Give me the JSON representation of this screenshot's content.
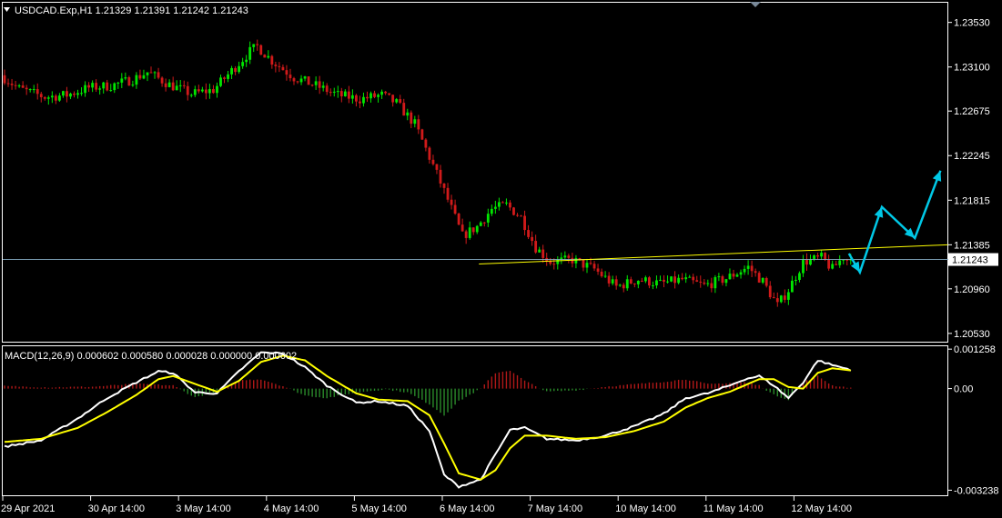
{
  "header": {
    "symbol_line": "USDCAD.Exp,H1  1.21329 1.21391 1.21242 1.21243",
    "macd_line": "MACD(12,26,9) 0.000602 0.000580 0.000028 0.000000 0.000602"
  },
  "colors": {
    "background": "#000000",
    "frame": "#ffffff",
    "bull_candle": "#00e600",
    "bear_candle": "#d01a1a",
    "trendline": "#ffff00",
    "price_line": "#8ab0c8",
    "projection_arrow": "#00c8e6",
    "macd_main": "#ffffff",
    "macd_signal": "#ffff00",
    "hist_up": "#b01818",
    "hist_down": "#2a8a2a"
  },
  "chart_data": [
    {
      "type": "candlestick",
      "series_name": "USDCAD.Exp,H1",
      "current_price": 1.21243,
      "current_price_label": "1.21243",
      "ylim": [
        1.2045,
        1.2372
      ],
      "y_ticks": [
        "1.23530",
        "1.23100",
        "1.22675",
        "1.22245",
        "1.21815",
        "1.21385",
        "1.20960",
        "1.20530"
      ],
      "y_tick_values": [
        1.2353,
        1.231,
        1.22675,
        1.22245,
        1.21815,
        1.21385,
        1.2096,
        1.2053
      ],
      "x_ticks": [
        "29 Apr 2021",
        "30 Apr 14:00",
        "3 May 14:00",
        "4 May 14:00",
        "5 May 14:00",
        "6 May 14:00",
        "7 May 14:00",
        "10 May 14:00",
        "11 May 14:00",
        "12 May 14:00"
      ],
      "x_tick_bars": [
        0,
        24,
        48,
        72,
        96,
        120,
        144,
        168,
        192,
        216
      ],
      "total_bars": 232,
      "close_path": [
        [
          0,
          1.2302
        ],
        [
          5,
          1.2289
        ],
        [
          12,
          1.2281
        ],
        [
          18,
          1.2283
        ],
        [
          24,
          1.229
        ],
        [
          30,
          1.2292
        ],
        [
          36,
          1.2298
        ],
        [
          40,
          1.2305
        ],
        [
          46,
          1.2293
        ],
        [
          52,
          1.2284
        ],
        [
          58,
          1.2288
        ],
        [
          64,
          1.231
        ],
        [
          68,
          1.2325
        ],
        [
          70,
          1.233
        ],
        [
          74,
          1.2316
        ],
        [
          80,
          1.23
        ],
        [
          86,
          1.2292
        ],
        [
          92,
          1.2283
        ],
        [
          98,
          1.2279
        ],
        [
          104,
          1.2283
        ],
        [
          108,
          1.2275
        ],
        [
          113,
          1.2255
        ],
        [
          118,
          1.2215
        ],
        [
          122,
          1.2182
        ],
        [
          126,
          1.2147
        ],
        [
          130,
          1.2156
        ],
        [
          134,
          1.2173
        ],
        [
          138,
          1.2177
        ],
        [
          142,
          1.2165
        ],
        [
          146,
          1.2136
        ],
        [
          150,
          1.2122
        ],
        [
          156,
          1.2124
        ],
        [
          162,
          1.2115
        ],
        [
          168,
          1.2098
        ],
        [
          174,
          1.2105
        ],
        [
          180,
          1.2101
        ],
        [
          186,
          1.2105
        ],
        [
          192,
          1.2099
        ],
        [
          198,
          1.2106
        ],
        [
          204,
          1.2117
        ],
        [
          208,
          1.2103
        ],
        [
          212,
          1.208
        ],
        [
          215,
          1.2095
        ],
        [
          219,
          1.2122
        ],
        [
          224,
          1.2126
        ],
        [
          227,
          1.2115
        ],
        [
          230,
          1.2127
        ],
        [
          231,
          1.21243
        ]
      ],
      "trendline": {
        "from": [
          130,
          1.212
        ],
        "to": [
          258,
          1.21385
        ]
      },
      "projection": [
        [
          231,
          1.213
        ],
        [
          234,
          1.2112
        ],
        [
          240,
          1.2175
        ],
        [
          249,
          1.2145
        ],
        [
          256,
          1.221
        ]
      ]
    },
    {
      "type": "line+histogram",
      "series_name": "MACD(12,26,9)",
      "ylim": [
        -0.0034,
        0.00135
      ],
      "y_ticks": [
        "0.001258",
        "0.00",
        "-0.003238"
      ],
      "y_tick_values": [
        0.001258,
        0.0,
        -0.003238
      ],
      "main_path": [
        [
          0,
          -0.00185
        ],
        [
          10,
          -0.00165
        ],
        [
          20,
          -0.00095
        ],
        [
          28,
          -0.0003
        ],
        [
          36,
          0.0002
        ],
        [
          42,
          0.00055
        ],
        [
          46,
          0.0005
        ],
        [
          52,
          -0.00012
        ],
        [
          58,
          -0.00015
        ],
        [
          64,
          0.00055
        ],
        [
          70,
          0.00115
        ],
        [
          76,
          0.00112
        ],
        [
          82,
          0.00068
        ],
        [
          88,
          0.0001
        ],
        [
          96,
          -0.00045
        ],
        [
          102,
          -0.0004
        ],
        [
          110,
          -0.00055
        ],
        [
          116,
          -0.00135
        ],
        [
          120,
          -0.00275
        ],
        [
          124,
          -0.00312
        ],
        [
          130,
          -0.0029
        ],
        [
          134,
          -0.0021
        ],
        [
          138,
          -0.00132
        ],
        [
          142,
          -0.00125
        ],
        [
          148,
          -0.0016
        ],
        [
          156,
          -0.00165
        ],
        [
          164,
          -0.0015
        ],
        [
          172,
          -0.0012
        ],
        [
          180,
          -0.0008
        ],
        [
          186,
          -0.0003
        ],
        [
          192,
          -0.00015
        ],
        [
          198,
          0.0001
        ],
        [
          202,
          0.0003
        ],
        [
          206,
          0.0004
        ],
        [
          210,
          0.0001
        ],
        [
          214,
          -0.0003
        ],
        [
          218,
          0.0002
        ],
        [
          222,
          0.0009
        ],
        [
          226,
          0.00075
        ],
        [
          231,
          0.000602
        ]
      ],
      "signal_path": [
        [
          0,
          -0.0017
        ],
        [
          10,
          -0.0016
        ],
        [
          20,
          -0.00125
        ],
        [
          28,
          -0.00075
        ],
        [
          36,
          -0.0002
        ],
        [
          42,
          0.0003
        ],
        [
          46,
          0.0004
        ],
        [
          52,
          0.00015
        ],
        [
          58,
          -0.0001
        ],
        [
          64,
          0.00025
        ],
        [
          70,
          0.00085
        ],
        [
          76,
          0.00105
        ],
        [
          82,
          0.0009
        ],
        [
          88,
          0.0004
        ],
        [
          96,
          -0.00015
        ],
        [
          102,
          -0.00035
        ],
        [
          110,
          -0.0004
        ],
        [
          116,
          -0.00085
        ],
        [
          120,
          -0.00175
        ],
        [
          124,
          -0.0027
        ],
        [
          130,
          -0.0029
        ],
        [
          134,
          -0.0026
        ],
        [
          138,
          -0.0019
        ],
        [
          142,
          -0.0015
        ],
        [
          148,
          -0.0015
        ],
        [
          156,
          -0.0016
        ],
        [
          164,
          -0.00155
        ],
        [
          172,
          -0.00135
        ],
        [
          180,
          -0.00105
        ],
        [
          186,
          -0.0006
        ],
        [
          192,
          -0.0003
        ],
        [
          198,
          -0.0001
        ],
        [
          202,
          0.0001
        ],
        [
          206,
          0.0003
        ],
        [
          210,
          0.0003
        ],
        [
          214,
          5e-05
        ],
        [
          218,
          0.0
        ],
        [
          222,
          0.0005
        ],
        [
          226,
          0.00065
        ],
        [
          231,
          0.00058
        ]
      ],
      "histogram_path": [
        [
          0,
          8e-05
        ],
        [
          12,
          4e-05
        ],
        [
          24,
          6e-05
        ],
        [
          36,
          0.00015
        ],
        [
          46,
          0.0001
        ],
        [
          52,
          -0.00028
        ],
        [
          58,
          -8e-05
        ],
        [
          64,
          0.00026
        ],
        [
          70,
          0.0003
        ],
        [
          76,
          8e-05
        ],
        [
          82,
          -0.00022
        ],
        [
          88,
          -0.0003
        ],
        [
          96,
          -0.00012
        ],
        [
          104,
          -2e-05
        ],
        [
          110,
          -0.00012
        ],
        [
          116,
          -0.0005
        ],
        [
          120,
          -0.00085
        ],
        [
          124,
          -0.0004
        ],
        [
          130,
          0.0
        ],
        [
          134,
          0.0005
        ],
        [
          138,
          0.00058
        ],
        [
          142,
          0.00025
        ],
        [
          148,
          -0.0001
        ],
        [
          156,
          -5e-05
        ],
        [
          164,
          6e-05
        ],
        [
          172,
          0.00014
        ],
        [
          180,
          0.00022
        ],
        [
          186,
          0.0003
        ],
        [
          192,
          0.00014
        ],
        [
          198,
          0.00018
        ],
        [
          202,
          0.0002
        ],
        [
          206,
          0.0001
        ],
        [
          210,
          -0.0002
        ],
        [
          214,
          -0.00035
        ],
        [
          218,
          0.0002
        ],
        [
          222,
          0.0004
        ],
        [
          226,
          0.0001
        ],
        [
          231,
          2.8e-05
        ]
      ]
    }
  ]
}
